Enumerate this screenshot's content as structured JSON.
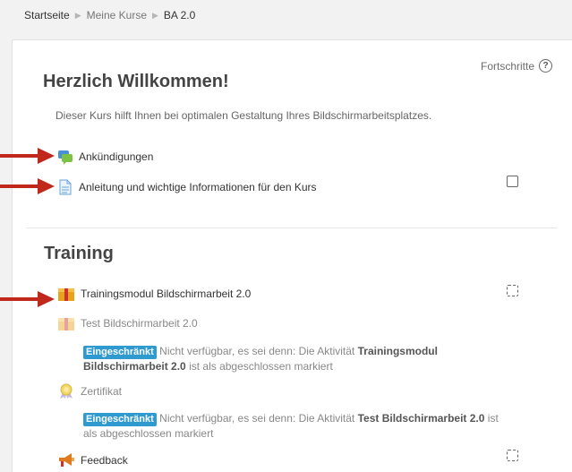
{
  "breadcrumb": {
    "items": [
      "Startseite",
      "Meine Kurse",
      "BA 2.0"
    ]
  },
  "header": {
    "progress_label": "Fortschritte",
    "help_symbol": "?"
  },
  "welcome": {
    "title": "Herzlich Willkommen!",
    "intro": "Dieser Kurs hilft Ihnen bei optimalen Gestaltung Ihres Bildschirmarbeitsplatzes."
  },
  "activities": {
    "announcements": "Ankündigungen",
    "guide": "Anleitung und wichtige Informationen für den Kurs"
  },
  "training": {
    "title": "Training",
    "module": "Trainingsmodul Bildschirmarbeit 2.0",
    "test": "Test Bildschirmarbeit 2.0",
    "restriction_badge": "Eingeschränkt",
    "restriction1_pre": "Nicht verfügbar, es sei denn: Die Aktivität",
    "restriction1_bold": "Trainingsmodul Bildschirmarbeit 2.0",
    "restriction1_post": "ist als abgeschlossen markiert",
    "certificate": "Zertifikat",
    "restriction2_pre": "Nicht verfügbar, es sei denn: Die Aktivität",
    "restriction2_bold": "Test Bildschirmarbeit 2.0",
    "restriction2_post": "ist als abgeschlossen markiert",
    "feedback": "Feedback"
  },
  "colors": {
    "arrow": "#c0281c",
    "badge": "#2e9ad0"
  }
}
